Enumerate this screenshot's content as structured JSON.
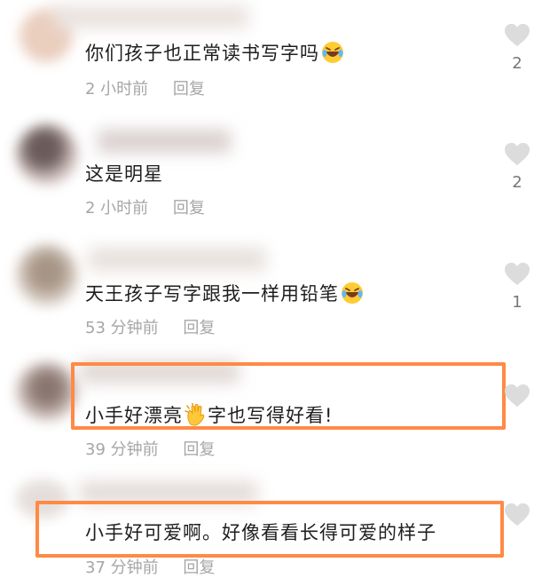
{
  "comments": [
    {
      "text": "你们孩子也正常读书写字吗",
      "emoji": "laughing-tears-emoji",
      "time": "2 小时前",
      "reply": "回复",
      "likes": "2"
    },
    {
      "text": "这是明星",
      "emoji": "",
      "time": "2 小时前",
      "reply": "回复",
      "likes": "2"
    },
    {
      "text": "天王孩子写字跟我一样用铅笔",
      "emoji": "laughing-tears-emoji",
      "time": "53 分钟前",
      "reply": "回复",
      "likes": "1"
    },
    {
      "text_a": "小手好漂亮",
      "emoji": "clapping-hands-emoji",
      "text_b": "字也写得好看!",
      "time": "39 分钟前",
      "reply": "回复",
      "likes": ""
    },
    {
      "text": "小手好可爱啊。好像看看长得可爱的样子",
      "time": "37 分钟前",
      "reply": "回复",
      "likes": ""
    }
  ],
  "colors": {
    "highlight": "#ff8a45",
    "meta": "#a6a6a6",
    "heart": "#d9d9d9"
  }
}
